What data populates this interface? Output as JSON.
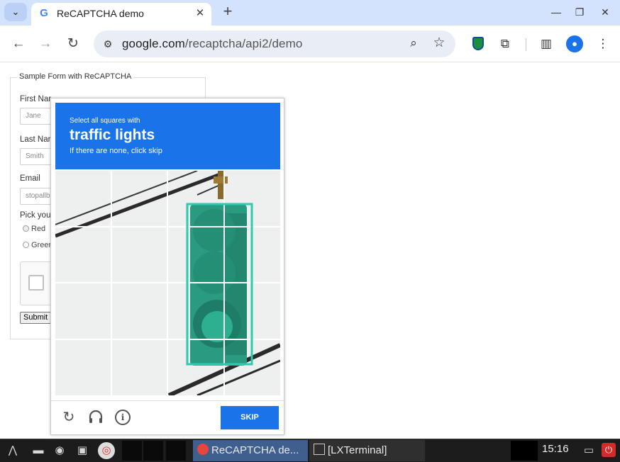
{
  "browser": {
    "tab_title": "ReCAPTCHA demo",
    "url_host": "google.com",
    "url_path": "/recaptcha/api2/demo",
    "new_tab_symbol": "+",
    "tab_close_symbol": "✕"
  },
  "page": {
    "form_legend": "Sample Form with ReCAPTCHA",
    "first_name_label": "First Nar",
    "first_name_value": "Jane",
    "last_name_label": "Last Nar",
    "last_name_value": "Smith",
    "email_label": "Email",
    "email_value": "stopallb",
    "pick_label": "Pick you",
    "radio_red": "Red",
    "radio_green": "Greer",
    "submit_label": "Submit"
  },
  "challenge": {
    "instruction_small": "Select all squares with",
    "target": "traffic lights",
    "instruction_sub": "If there are none, click skip",
    "skip_label": "SKIP",
    "info_symbol": "i",
    "colors": {
      "header": "#1a73e8",
      "selection": "#2fc9b0",
      "light_body": "#2a9a80"
    }
  },
  "taskbar": {
    "chrome_task": "ReCAPTCHA de...",
    "terminal_task": "[LXTerminal]",
    "clock": "15:16"
  }
}
